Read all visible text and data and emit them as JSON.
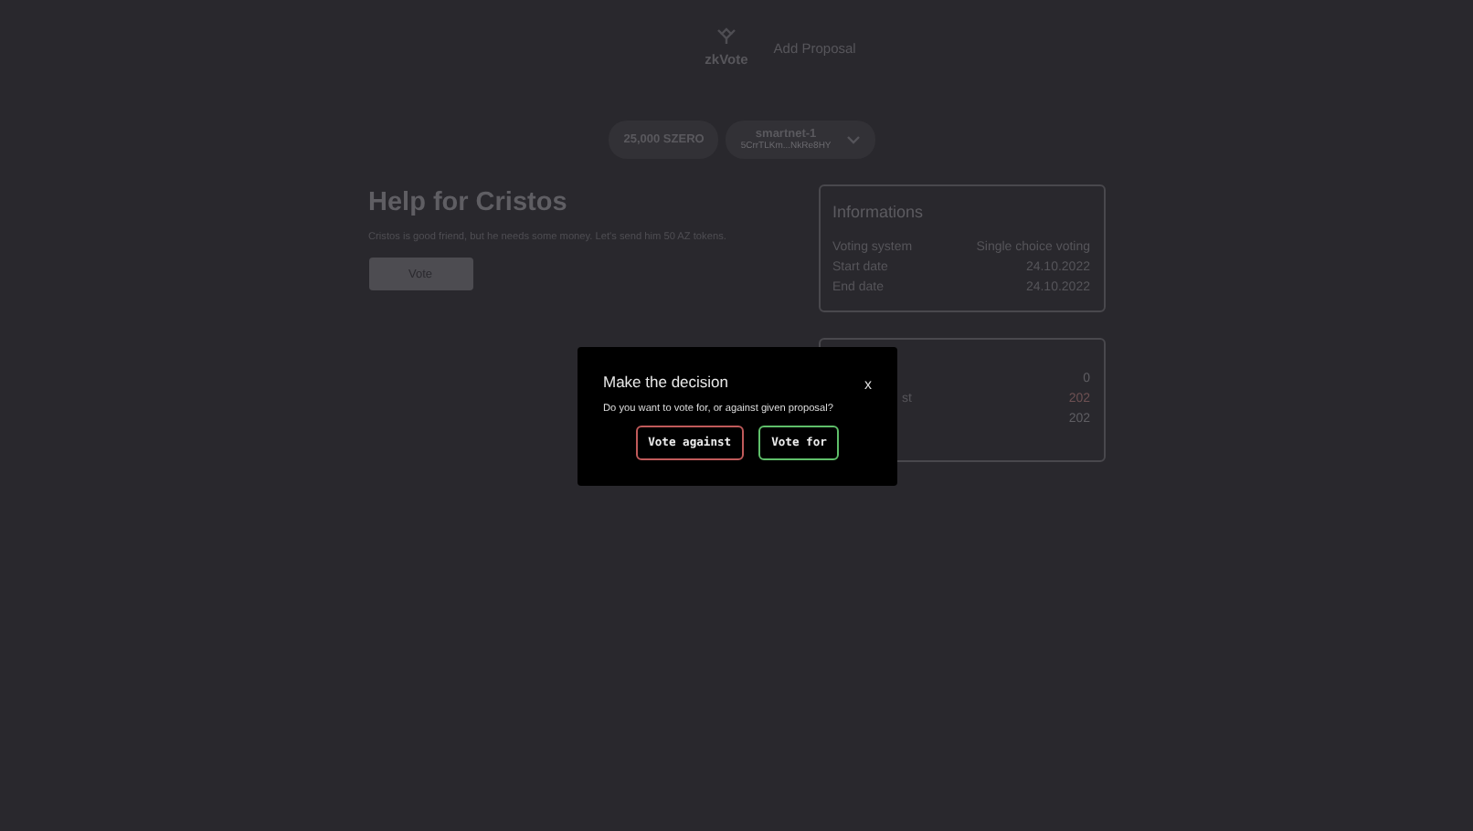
{
  "header": {
    "logo_text": "zkVote",
    "nav_link": "Add Proposal"
  },
  "wallet": {
    "balance": "25,000 SZERO",
    "network": "smartnet-1",
    "address": "5CrrTLKm...NkRe8HY",
    "dropdown_open": false
  },
  "proposal": {
    "title": "Help for Cristos",
    "description": "Cristos is good friend, but he needs some money. Let's send him 50 AZ tokens.",
    "vote_button": "Vote"
  },
  "info_card": {
    "title": "Informations",
    "rows": [
      {
        "label": "Voting system",
        "value": "Single choice voting"
      },
      {
        "label": "Start date",
        "value": "24.10.2022"
      },
      {
        "label": "End date",
        "value": "24.10.2022"
      }
    ]
  },
  "results_card": {
    "rows": [
      {
        "label_fragment": "",
        "value": "0",
        "color": "#5f5e63"
      },
      {
        "label_fragment": "st",
        "value": "202",
        "color": "#6e5153"
      },
      {
        "label_fragment": "",
        "value": "202",
        "color": "#5f5e63"
      }
    ]
  },
  "modal": {
    "title": "Make the decision",
    "close": "x",
    "question": "Do you want to vote for, or against given proposal?",
    "buttons": [
      {
        "label": "Vote against",
        "kind": "against"
      },
      {
        "label": "Vote for",
        "kind": "for"
      }
    ]
  }
}
